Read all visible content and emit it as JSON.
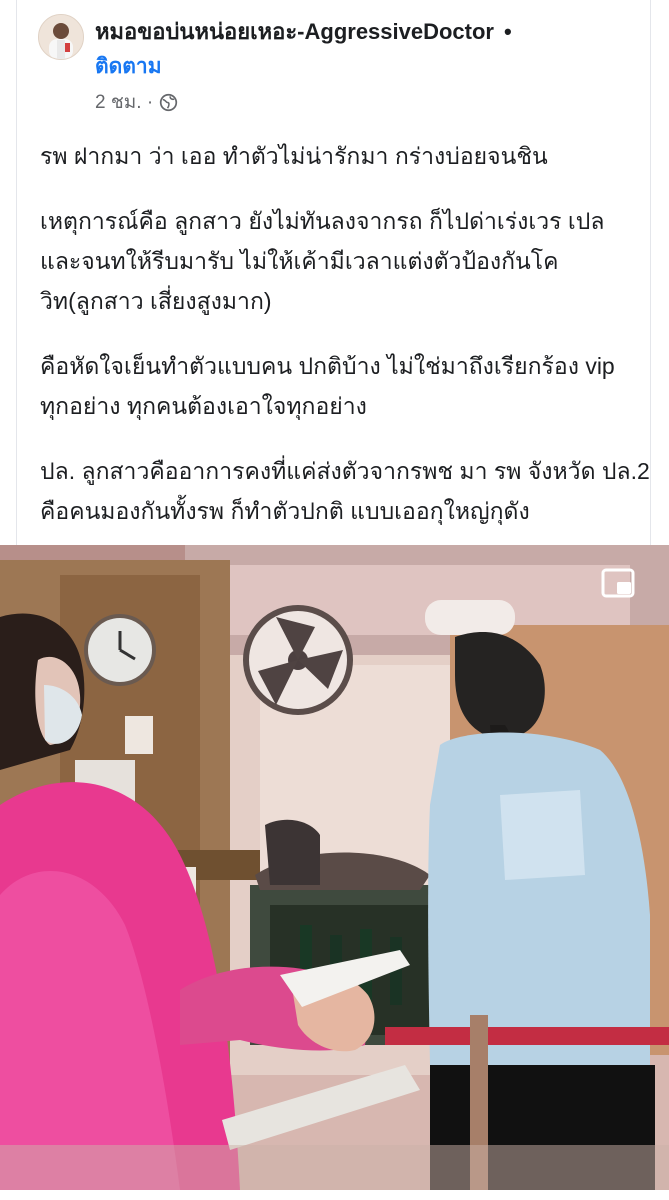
{
  "post": {
    "author_name": "หมอขอบ่นหน่อยเหอะ-AggressiveDoctor",
    "separator": "•",
    "follow_label": "ติดตาม",
    "time": "2 ชม. ·",
    "privacy_icon": "globe-icon",
    "paragraphs": [
      "รพ ฝากมา ว่า เออ ทำตัวไม่น่ารักมา กร่างบ่อยจนชิน",
      "เหตุการณ์คือ ลูกสาว ยังไม่ทันลงจากรถ ก็ไปด่าเร่งเวร เปล และจนทให้รีบมารับ ไม่ให้เค้ามีเวลาแต่งตัวป้องกันโควิท(ลูกสาว เสี่ยงสูงมาก)",
      "คือหัดใจเย็นทำตัวแบบคน ปกติบ้าง ไม่ใช่มาถึงเรียกร้อง vip ทุกอย่าง ทุกคนต้องเอาใจทุกอย่าง",
      "ปล. ลูกสาวคืออาการคงที่แค่ส่งตัวจากรพช มา รพ จังหวัด ปล.2 คือคนมองกันทั้งรพ ก็ทำตัวปกติ แบบเออกุใหญ่กุดัง"
    ]
  },
  "media": {
    "pip_icon": "picture-in-picture-icon"
  },
  "colors": {
    "link_blue": "#1877f2",
    "secondary_text": "#65676b",
    "primary_text": "#1c1e21"
  }
}
